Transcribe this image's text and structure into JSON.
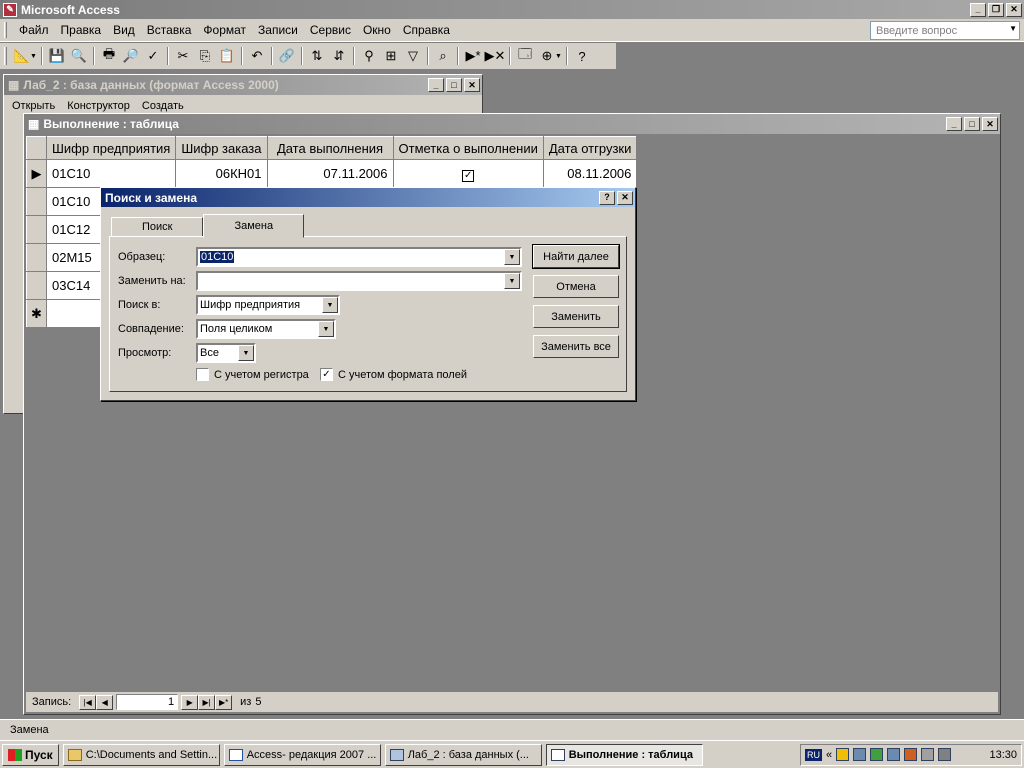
{
  "app": {
    "title": "Microsoft Access"
  },
  "menu": [
    "Файл",
    "Правка",
    "Вид",
    "Вставка",
    "Формат",
    "Записи",
    "Сервис",
    "Окно",
    "Справка"
  ],
  "question_box": {
    "placeholder": "Введите вопрос"
  },
  "db_window": {
    "title": "Лаб_2 : база данных (формат Access 2000)",
    "toolbar": [
      "Открыть",
      "Конструктор",
      "Создать"
    ]
  },
  "table_window": {
    "title": "Выполнение : таблица",
    "columns": [
      "Шифр предприятия",
      "Шифр заказа",
      "Дата выполнения",
      "Отметка о выполнении",
      "Дата отгрузки"
    ],
    "rows": [
      {
        "enterprise": "01С10",
        "order": "06КН01",
        "date_done": "07.11.2006",
        "checked": true,
        "date_ship": "08.11.2006"
      },
      {
        "enterprise": "01С10"
      },
      {
        "enterprise": "01С12"
      },
      {
        "enterprise": "02М15"
      },
      {
        "enterprise": "03С14"
      }
    ],
    "nav": {
      "label": "Запись:",
      "current": "1",
      "of": "из",
      "total": "5"
    }
  },
  "dialog": {
    "title": "Поиск и замена",
    "tabs": {
      "find": "Поиск",
      "replace": "Замена"
    },
    "labels": {
      "sample": "Образец:",
      "replace_with": "Заменить на:",
      "search_in": "Поиск в:",
      "match": "Совпадение:",
      "direction": "Просмотр:"
    },
    "values": {
      "sample": "01С10",
      "replace_with": "",
      "search_in": "Шифр предприятия",
      "match": "Поля целиком",
      "direction": "Все"
    },
    "checkboxes": {
      "match_case": {
        "label": "С учетом регистра",
        "checked": false
      },
      "match_format": {
        "label": "С учетом формата полей",
        "checked": true
      }
    },
    "buttons": {
      "find_next": "Найти далее",
      "cancel": "Отмена",
      "replace": "Заменить",
      "replace_all": "Заменить все"
    }
  },
  "status": {
    "text": "Замена"
  },
  "taskbar": {
    "start": "Пуск",
    "tasks": [
      "C:\\Documents and Settin...",
      "Access- редакция 2007 ...",
      "Лаб_2 : база данных (...",
      "Выполнение : таблица"
    ],
    "lang": "RU",
    "clock": "13:30"
  }
}
